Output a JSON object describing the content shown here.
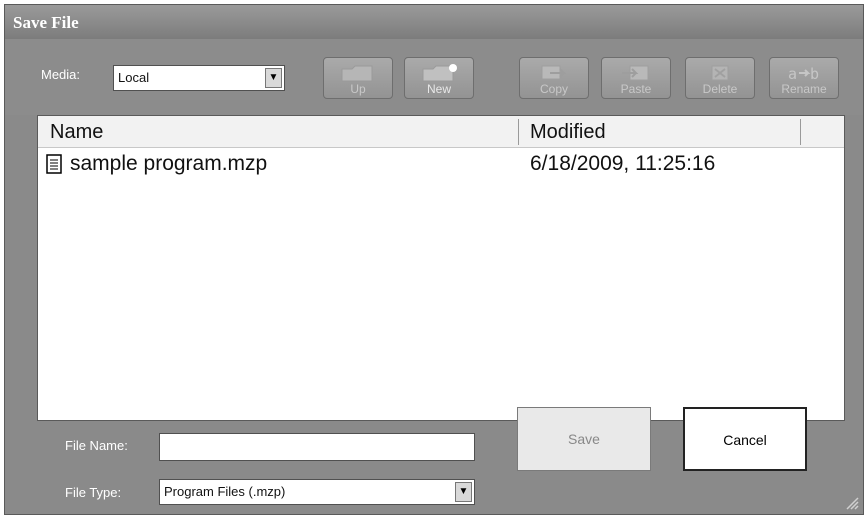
{
  "window": {
    "title": "Save File"
  },
  "toolbar": {
    "media_label": "Media:",
    "media_value": "Local",
    "buttons": {
      "up": "Up",
      "new": "New",
      "copy": "Copy",
      "paste": "Paste",
      "delete": "Delete",
      "rename": "Rename"
    }
  },
  "file_list": {
    "columns": {
      "name": "Name",
      "modified": "Modified"
    },
    "rows": [
      {
        "name": "sample program.mzp",
        "modified": "6/18/2009, 11:25:16"
      }
    ]
  },
  "footer": {
    "file_name_label": "File Name:",
    "file_name_value": "",
    "file_type_label": "File Type:",
    "file_type_value": "Program Files (.mzp)",
    "save_label": "Save",
    "cancel_label": "Cancel"
  },
  "icons": [
    "dropdown-arrow-icon",
    "folder-up-icon",
    "new-folder-icon",
    "copy-icon",
    "paste-icon",
    "delete-icon",
    "rename-icon",
    "document-icon",
    "resize-grip-icon"
  ],
  "colors": {
    "dialog_bg": "#8a8a8a",
    "list_bg": "#ffffff",
    "disabled_button": "#e9e9e9"
  }
}
